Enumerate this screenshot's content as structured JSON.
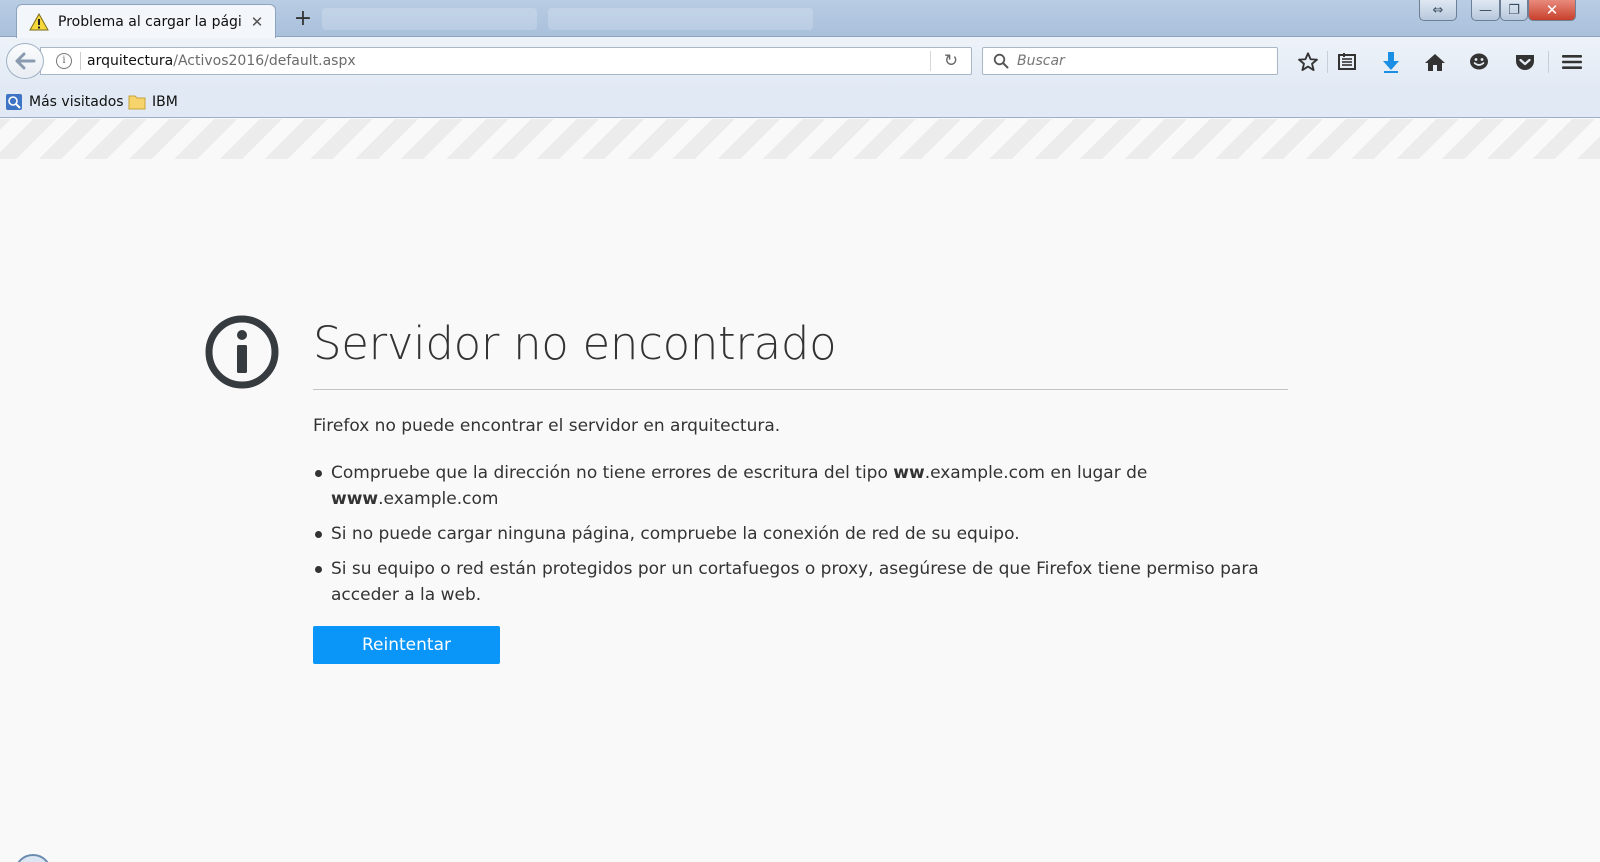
{
  "browser": {
    "active_tab": {
      "title": "Problema al cargar la pági...",
      "close": "✕"
    },
    "new_tab": "+",
    "window_controls": {
      "restore_size": "⇔",
      "minimize": "—",
      "maximize": "❐",
      "close": "✕"
    }
  },
  "toolbar": {
    "url_host": "arquitectura",
    "url_path": "/Activos2016/default.aspx",
    "reload": "↻",
    "search_placeholder": "Buscar"
  },
  "bookmarks": [
    {
      "label": "Más visitados",
      "icon": "most-visited-icon"
    },
    {
      "label": "IBM",
      "icon": "folder-icon"
    }
  ],
  "error": {
    "title": "Servidor no encontrado",
    "description": "Firefox no puede encontrar el servidor en arquitectura.",
    "bullet1_a": "Compruebe que la dirección no tiene errores de escritura del tipo ",
    "bullet1_b": "ww",
    "bullet1_c": ".example.com en lugar de ",
    "bullet1_d": "www",
    "bullet1_e": ".example.com",
    "bullet2": "Si no puede cargar ninguna página, compruebe la conexión de red de su equipo.",
    "bullet3": "Si su equipo o red están protegidos por un cortafuegos o proxy, asegúrese de que Firefox tiene permiso para acceder a la web.",
    "retry_label": "Reintentar"
  },
  "colors": {
    "accent_button": "#0996f8",
    "download_arrow": "#1a8fe3",
    "error_icon": "#363b40"
  }
}
